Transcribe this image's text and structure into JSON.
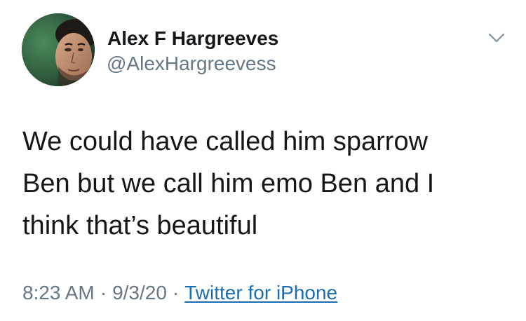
{
  "author": {
    "display_name": "Alex F Hargreeves",
    "handle": "@AlexHargreevess",
    "avatar_icon": "profile-photo"
  },
  "menu": {
    "icon": "chevron-down-icon"
  },
  "tweet": {
    "lines": [
      "We could have called him sparrow",
      "Ben but we call him emo Ben and I",
      "think that’s beautiful"
    ]
  },
  "meta": {
    "time": "8:23 AM",
    "separator": "·",
    "date": "9/3/20",
    "source": "Twitter for iPhone"
  },
  "colors": {
    "text": "#14171a",
    "secondary": "#657786",
    "link": "#1b6db3"
  }
}
